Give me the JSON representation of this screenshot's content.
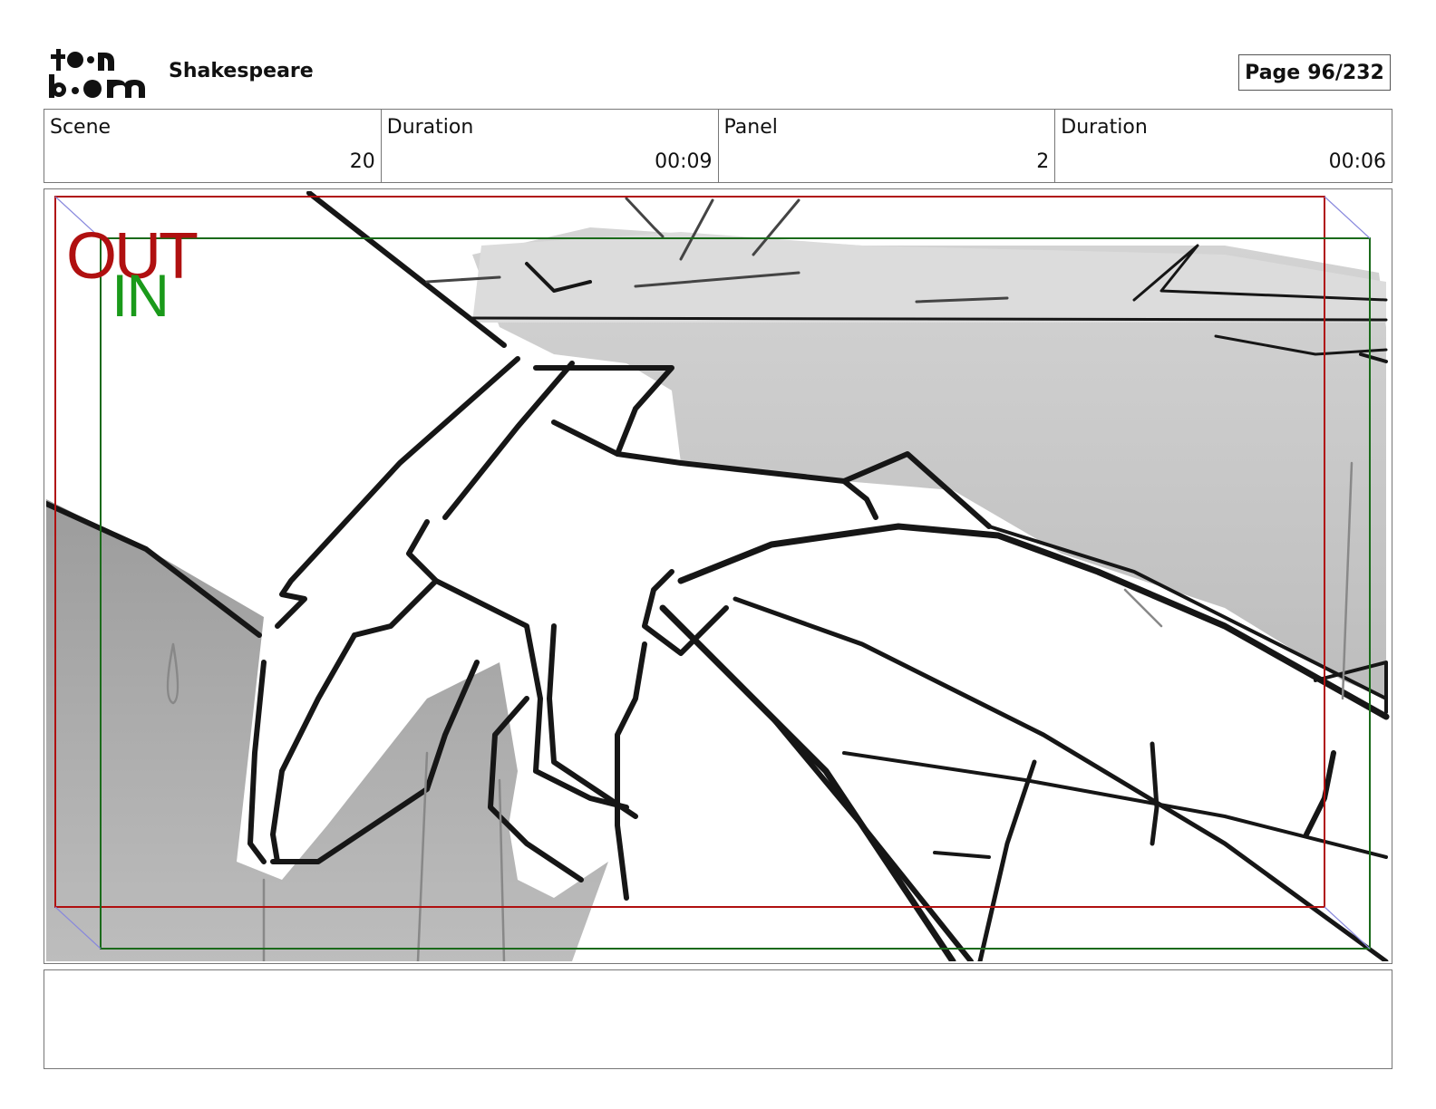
{
  "header": {
    "logo_text": "toon boom",
    "project_title": "Shakespeare",
    "page_label": "Page",
    "page_number": "96/232"
  },
  "info": {
    "scene_label": "Scene",
    "scene_value": "20",
    "scene_duration_label": "Duration",
    "scene_duration_value": "00:09",
    "panel_label": "Panel",
    "panel_value": "2",
    "panel_duration_label": "Duration",
    "panel_duration_value": "00:06"
  },
  "panel": {
    "out_label": "OUT",
    "in_label": "IN",
    "out_color": "#b01010",
    "in_color": "#1a9a1a"
  },
  "notes": {
    "text": ""
  }
}
